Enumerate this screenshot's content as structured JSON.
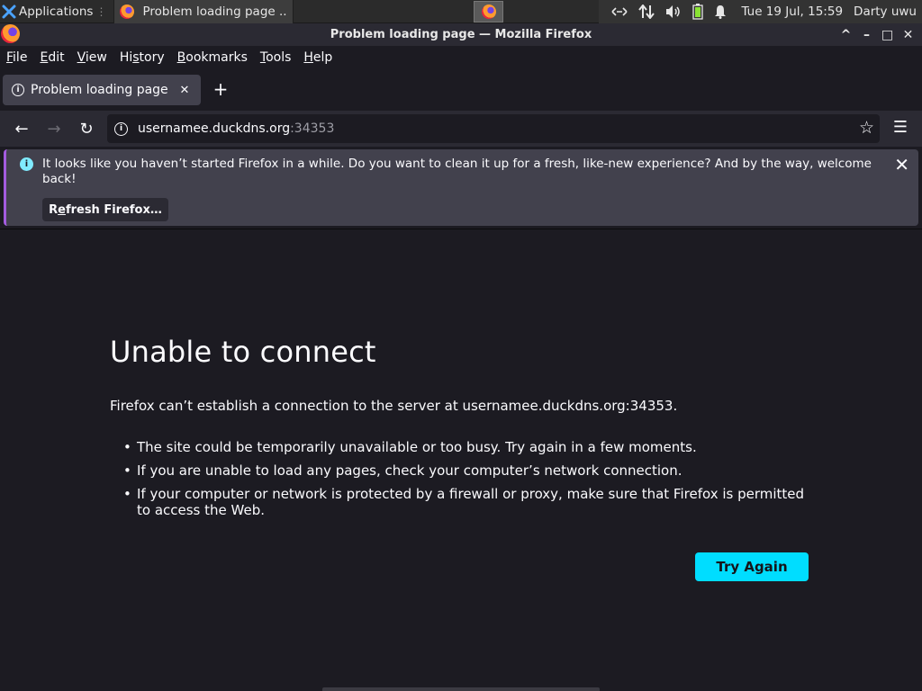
{
  "panel": {
    "apps_label": "Applications",
    "apps_separator": "⋮",
    "task_title": "Problem loading page ...",
    "clock": "Tue 19 Jul, 15:59",
    "user": "Darty uwu",
    "tray_icons": [
      "network-arrows-icon",
      "transfer-icon",
      "volume-icon",
      "battery-icon",
      "notification-bell-icon"
    ]
  },
  "window": {
    "title": "Problem loading page — Mozilla Firefox",
    "controls": [
      "^",
      "–",
      "□",
      "✕"
    ]
  },
  "menubar": {
    "items": [
      {
        "pre": "",
        "key": "F",
        "post": "ile"
      },
      {
        "pre": "",
        "key": "E",
        "post": "dit"
      },
      {
        "pre": "",
        "key": "V",
        "post": "iew"
      },
      {
        "pre": "Hi",
        "key": "s",
        "post": "tory"
      },
      {
        "pre": "",
        "key": "B",
        "post": "ookmarks"
      },
      {
        "pre": "",
        "key": "T",
        "post": "ools"
      },
      {
        "pre": "",
        "key": "H",
        "post": "elp"
      }
    ]
  },
  "tab": {
    "label": "Problem loading page",
    "close": "✕",
    "new_tab": "+"
  },
  "nav": {
    "back": "←",
    "forward": "→",
    "reload": "↻",
    "url_host": "usernamee.duckdns.org",
    "url_port": ":34353",
    "bookmark_star": "☆",
    "menu": "☰"
  },
  "notice": {
    "text": "It looks like you haven’t started Firefox in a while. Do you want to clean it up for a fresh, like-new experience? And by the way, welcome back!",
    "button_pre": "R",
    "button_key": "e",
    "button_post": "fresh Firefox…",
    "close": "✕"
  },
  "error": {
    "title": "Unable to connect",
    "description": "Firefox can’t establish a connection to the server at usernamee.duckdns.org:34353.",
    "bullets": [
      "The site could be temporarily unavailable or too busy. Try again in a few moments.",
      "If you are unable to load any pages, check your computer’s network connection.",
      "If your computer or network is protected by a firewall or proxy, make sure that Firefox is permitted to access the Web."
    ],
    "try_again": "Try Again"
  },
  "colors": {
    "page_bg": "#1c1b22",
    "toolbar_bg": "#2b2a33",
    "accent": "#00ddff",
    "notice_bg": "#42414d"
  }
}
